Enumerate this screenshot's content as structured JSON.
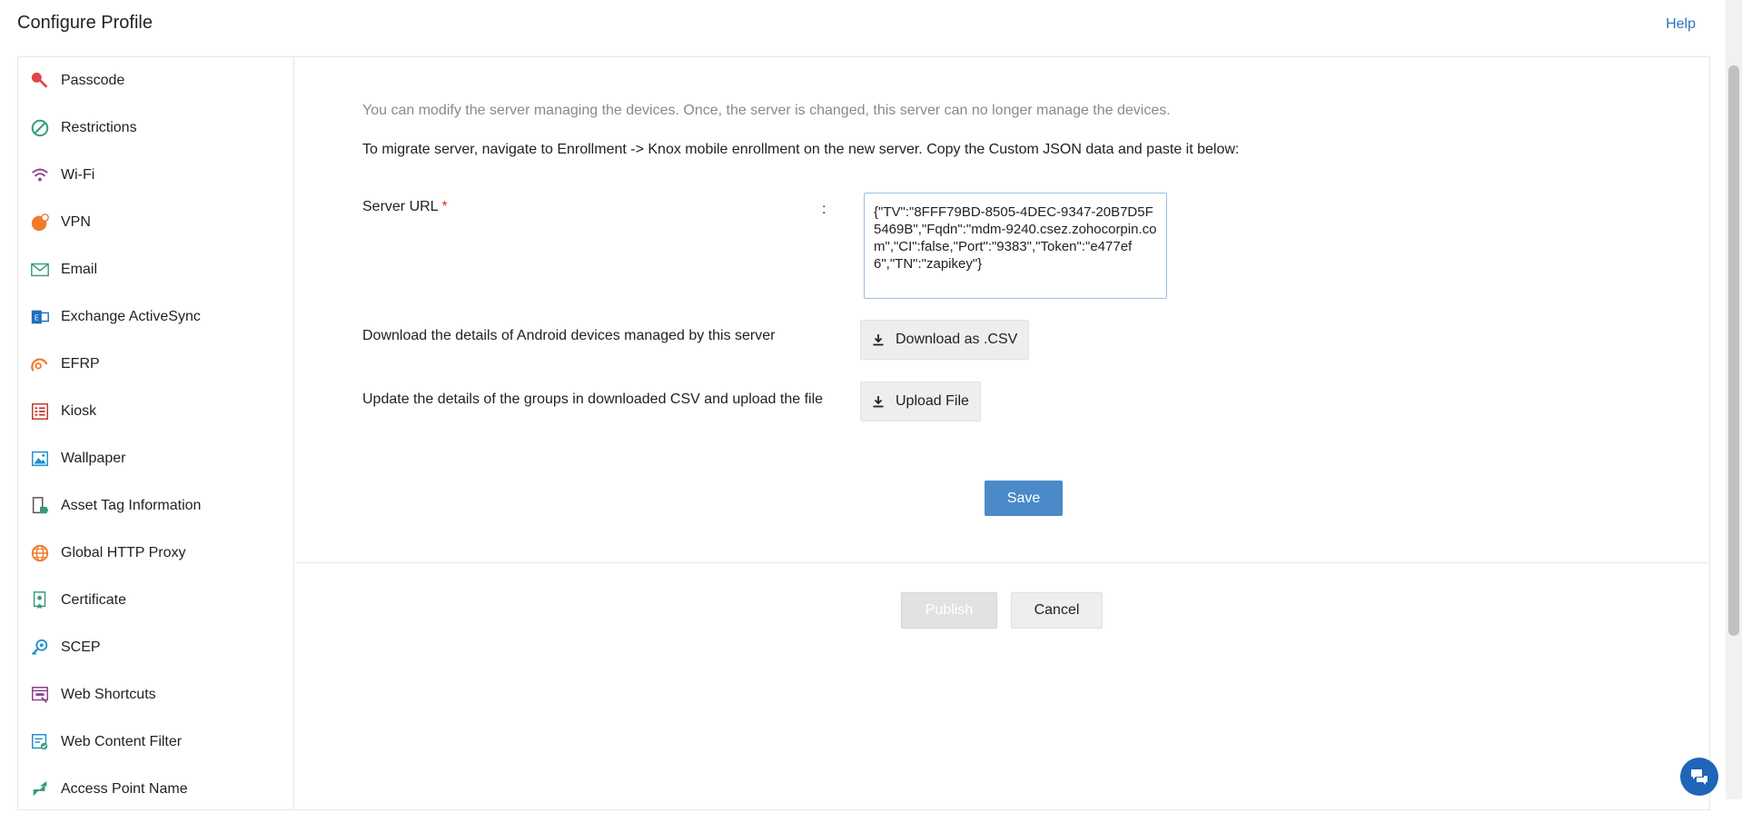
{
  "header": {
    "title": "Configure Profile",
    "help_label": "Help"
  },
  "sidebar": {
    "items": [
      {
        "label": "Passcode",
        "icon": "key-icon"
      },
      {
        "label": "Restrictions",
        "icon": "restriction-icon"
      },
      {
        "label": "Wi-Fi",
        "icon": "wifi-icon"
      },
      {
        "label": "VPN",
        "icon": "vpn-icon"
      },
      {
        "label": "Email",
        "icon": "email-icon"
      },
      {
        "label": "Exchange ActiveSync",
        "icon": "exchange-icon"
      },
      {
        "label": "EFRP",
        "icon": "efrp-icon"
      },
      {
        "label": "Kiosk",
        "icon": "kiosk-icon"
      },
      {
        "label": "Wallpaper",
        "icon": "wallpaper-icon"
      },
      {
        "label": "Asset Tag Information",
        "icon": "asset-tag-icon"
      },
      {
        "label": "Global HTTP Proxy",
        "icon": "globe-icon"
      },
      {
        "label": "Certificate",
        "icon": "certificate-icon"
      },
      {
        "label": "SCEP",
        "icon": "scep-icon"
      },
      {
        "label": "Web Shortcuts",
        "icon": "web-shortcut-icon"
      },
      {
        "label": "Web Content Filter",
        "icon": "web-filter-icon"
      },
      {
        "label": "Access Point Name",
        "icon": "access-point-icon"
      }
    ]
  },
  "main": {
    "info_text": "You can modify the server managing the devices. Once, the server is changed, this server can no longer manage the devices.",
    "migrate_text": "To migrate server, navigate to Enrollment -> Knox mobile enrollment on the new server. Copy the Custom JSON data and paste it below:",
    "server_url_label": "Server URL",
    "required_mark": "*",
    "colon": ":",
    "server_url_value": "{\"TV\":\"8FFF79BD-8505-4DEC-9347-20B7D5F5469B\",\"Fqdn\":\"mdm-9240.csez.zohocorpin.com\",\"CI\":false,\"Port\":\"9383\",\"Token\":\"e477ef6\",\"TN\":\"zapikey\"}",
    "download_label": "Download the details of Android devices managed by this server",
    "download_button": "Download as .CSV",
    "upload_label": "Update the details of the groups in downloaded CSV and upload the file",
    "upload_button": "Upload File",
    "save_button": "Save"
  },
  "footer": {
    "publish_button": "Publish",
    "cancel_button": "Cancel"
  },
  "colors": {
    "accent": "#4a8ac9",
    "link": "#2f74c0",
    "required": "#e03131",
    "chat": "#1f65b8"
  }
}
